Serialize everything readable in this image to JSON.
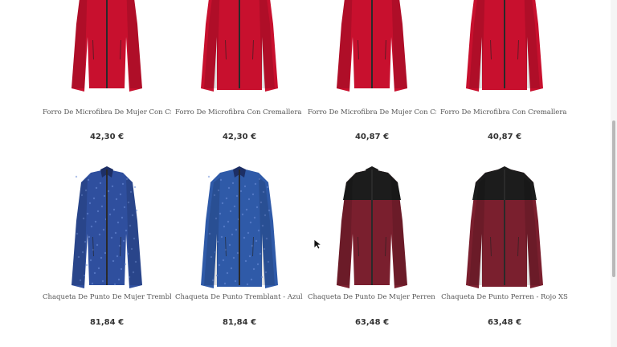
{
  "products": [
    {
      "title": "Forro De Microfibra De Mujer Con Cr...",
      "price": "42,30 €",
      "garment": "fleece-women",
      "color": "#c8102e",
      "accent": "#8a0a1f"
    },
    {
      "title": "Forro De Microfibra Con Cremallera ...",
      "price": "42,30 €",
      "garment": "fleece-men",
      "color": "#c8102e",
      "accent": "#8a0a1f"
    },
    {
      "title": "Forro De Microfibra De Mujer Con Cr...",
      "price": "40,87 €",
      "garment": "fleece-women",
      "color": "#c8102e",
      "accent": "#8a0a1f"
    },
    {
      "title": "Forro De Microfibra Con Cremallera ...",
      "price": "40,87 €",
      "garment": "fleece-men",
      "color": "#c8102e",
      "accent": "#8a0a1f"
    },
    {
      "title": "Chaqueta De Punto De Mujer Trembl...",
      "price": "81,84 €",
      "garment": "knit-women",
      "color": "#2f4f9e",
      "accent": "#1d2f66"
    },
    {
      "title": "Chaqueta De Punto Tremblant - Azul ...",
      "price": "81,84 €",
      "garment": "knit-men",
      "color": "#2f5aa8",
      "accent": "#1d2f66"
    },
    {
      "title": "Chaqueta De Punto De Mujer Perren -...",
      "price": "63,48 €",
      "garment": "softshell-women",
      "color": "#7a1f2e",
      "accent": "#1c1c1c"
    },
    {
      "title": "Chaqueta De Punto Perren - Rojo XS",
      "price": "63,48 €",
      "garment": "softshell-men",
      "color": "#7a1f2e",
      "accent": "#1c1c1c"
    }
  ],
  "icons": {
    "cursor": "mouse-pointer-icon"
  }
}
